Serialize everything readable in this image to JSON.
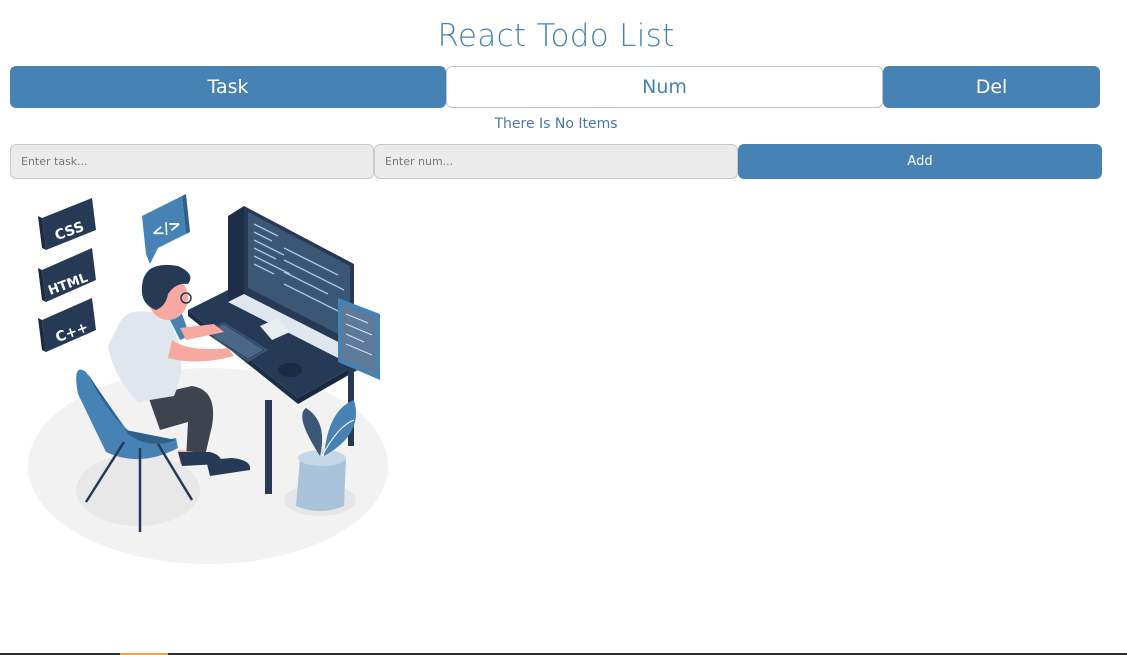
{
  "app": {
    "title": "React Todo List"
  },
  "table": {
    "headers": [
      "Task",
      "Num",
      "Del"
    ],
    "empty_message": "There Is No Items"
  },
  "form": {
    "task_placeholder": "Enter task...",
    "num_placeholder": "Enter num...",
    "add_label": "Add"
  },
  "illustration": {
    "tags": [
      "CSS",
      "HTML",
      "C++"
    ],
    "code_bubble": "</>"
  },
  "colors": {
    "accent": "#4682b4",
    "dark": "#263a56",
    "input_bg": "#ebebeb",
    "skin": "#f7a8a0"
  }
}
